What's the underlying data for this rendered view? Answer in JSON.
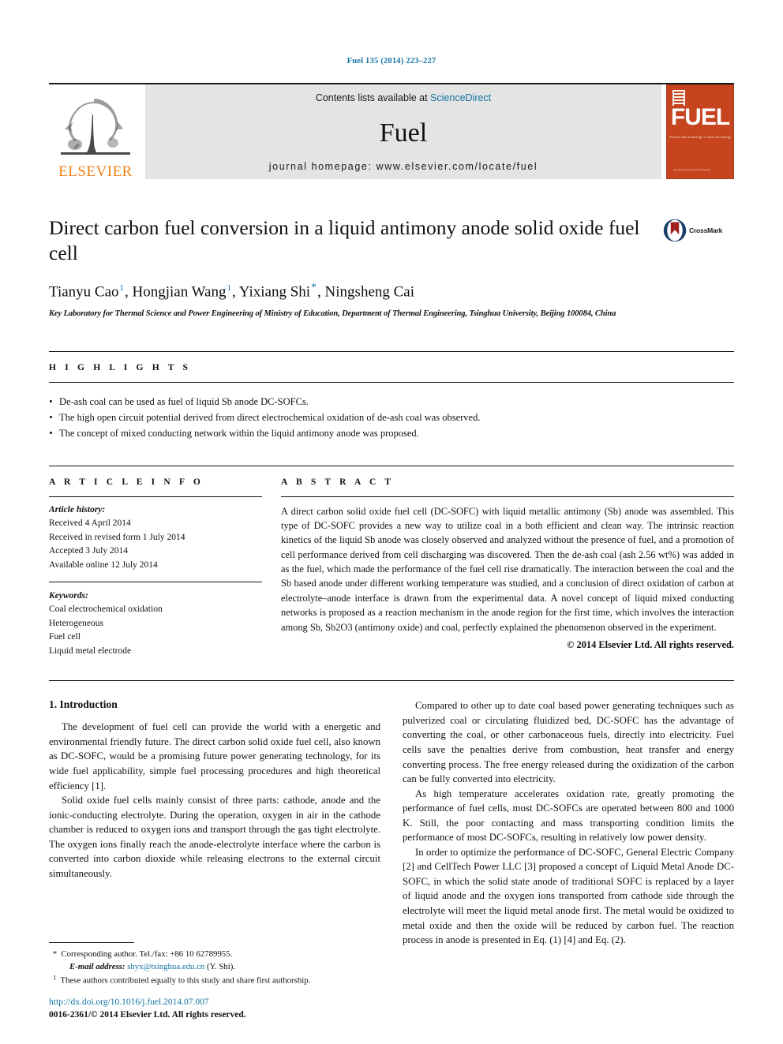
{
  "running_head": "Fuel 135 (2014) 223–227",
  "masthead": {
    "publisher_name": "ELSEVIER",
    "contents_prefix": "Contents lists available at ",
    "contents_link": "ScienceDirect",
    "journal_name": "Fuel",
    "homepage": "journal homepage: www.elsevier.com/locate/fuel",
    "cover": {
      "wordmark": "FUEL",
      "subtitle": "Science and technology of fuels and energy",
      "footer": "An International Journal\nElsevier"
    }
  },
  "article": {
    "title": "Direct carbon fuel conversion in a liquid antimony anode solid oxide fuel cell",
    "crossmark_label": "CrossMark",
    "authors": [
      {
        "name": "Tianyu Cao",
        "sup": "1"
      },
      {
        "name": "Hongjian Wang",
        "sup": "1"
      },
      {
        "name": "Yixiang Shi",
        "sup": "*"
      },
      {
        "name": "Ningsheng Cai",
        "sup": ""
      }
    ],
    "affiliation": "Key Laboratory for Thermal Science and Power Engineering of Ministry of Education, Department of Thermal Engineering, Tsinghua University, Beijing 100084, China"
  },
  "highlights": {
    "label": "H I G H L I G H T S",
    "items": [
      "De-ash coal can be used as fuel of liquid Sb anode DC-SOFCs.",
      "The high open circuit potential derived from direct electrochemical oxidation of de-ash coal was observed.",
      "The concept of mixed conducting network within the liquid antimony anode was proposed."
    ]
  },
  "article_info": {
    "label": "A R T I C L E    I N F O",
    "history_heading": "Article history:",
    "history": [
      "Received 4 April 2014",
      "Received in revised form 1 July 2014",
      "Accepted 3 July 2014",
      "Available online 12 July 2014"
    ],
    "keywords_heading": "Keywords:",
    "keywords": [
      "Coal electrochemical oxidation",
      "Heterogeneous",
      "Fuel cell",
      "Liquid metal electrode"
    ]
  },
  "abstract": {
    "label": "A B S T R A C T",
    "text": "A direct carbon solid oxide fuel cell (DC-SOFC) with liquid metallic antimony (Sb) anode was assembled. This type of DC-SOFC provides a new way to utilize coal in a both efficient and clean way. The intrinsic reaction kinetics of the liquid Sb anode was closely observed and analyzed without the presence of fuel, and a promotion of cell performance derived from cell discharging was discovered. Then the de-ash coal (ash 2.56 wt%) was added in as the fuel, which made the performance of the fuel cell rise dramatically. The interaction between the coal and the Sb based anode under different working temperature was studied, and a conclusion of direct oxidation of carbon at electrolyte–anode interface is drawn from the experimental data. A novel concept of liquid mixed conducting networks is proposed as a reaction mechanism in the anode region for the first time, which involves the interaction among Sb, Sb2O3 (antimony oxide) and coal, perfectly explained the phenomenon observed in the experiment.",
    "copyright": "© 2014 Elsevier Ltd. All rights reserved."
  },
  "body": {
    "section_title": "1. Introduction",
    "left_paragraphs": [
      "The development of fuel cell can provide the world with a energetic and environmental friendly future. The direct carbon solid oxide fuel cell, also known as DC-SOFC, would be a promising future power generating technology, for its wide fuel applicability, simple fuel processing procedures and high theoretical efficiency [1].",
      "Solid oxide fuel cells mainly consist of three parts: cathode, anode and the ionic-conducting electrolyte. During the operation, oxygen in air in the cathode chamber is reduced to oxygen ions and transport through the gas tight electrolyte. The oxygen ions finally reach the anode-electrolyte interface where the carbon is converted into carbon dioxide while releasing electrons to the external circuit simultaneously."
    ],
    "right_paragraphs": [
      "Compared to other up to date coal based power generating techniques such as pulverized coal or circulating fluidized bed, DC-SOFC has the advantage of converting the coal, or other carbonaceous fuels, directly into electricity. Fuel cells save the penalties derive from combustion, heat transfer and energy converting process. The free energy released during the oxidization of the carbon can be fully converted into electricity.",
      "As high temperature accelerates oxidation rate, greatly promoting the performance of fuel cells, most DC-SOFCs are operated between 800 and 1000 K. Still, the poor contacting and mass transporting condition limits the performance of most DC-SOFCs, resulting in relatively low power density.",
      "In order to optimize the performance of DC-SOFC, General Electric Company [2] and CellTech Power LLC [3] proposed a concept of Liquid Metal Anode DC-SOFC, in which the solid state anode of traditional SOFC is replaced by a layer of liquid anode and the oxygen ions transported from cathode side through the electrolyte will meet the liquid metal anode first. The metal would be oxidized to metal oxide and then the oxide will be reduced by carbon fuel. The reaction process in anode is presented in Eq. (1) [4] and Eq. (2)."
    ]
  },
  "footnotes": {
    "corresponding": "Corresponding author. Tel./fax: +86 10 62789955.",
    "email_label": "E-mail address:",
    "email": "shyx@tsinghua.edu.cn",
    "email_suffix": "(Y. Shi).",
    "equal_contribution": "These authors contributed equally to this study and share first authorship.",
    "doi": "http://dx.doi.org/10.1016/j.fuel.2014.07.007",
    "issn": "0016-2361/© 2014 Elsevier Ltd. All rights reserved."
  },
  "colors": {
    "link": "#1474a4",
    "elsevier_orange": "#f08019",
    "cover_orange": "#c6441e",
    "masthead_grey": "#e4e4e4"
  }
}
